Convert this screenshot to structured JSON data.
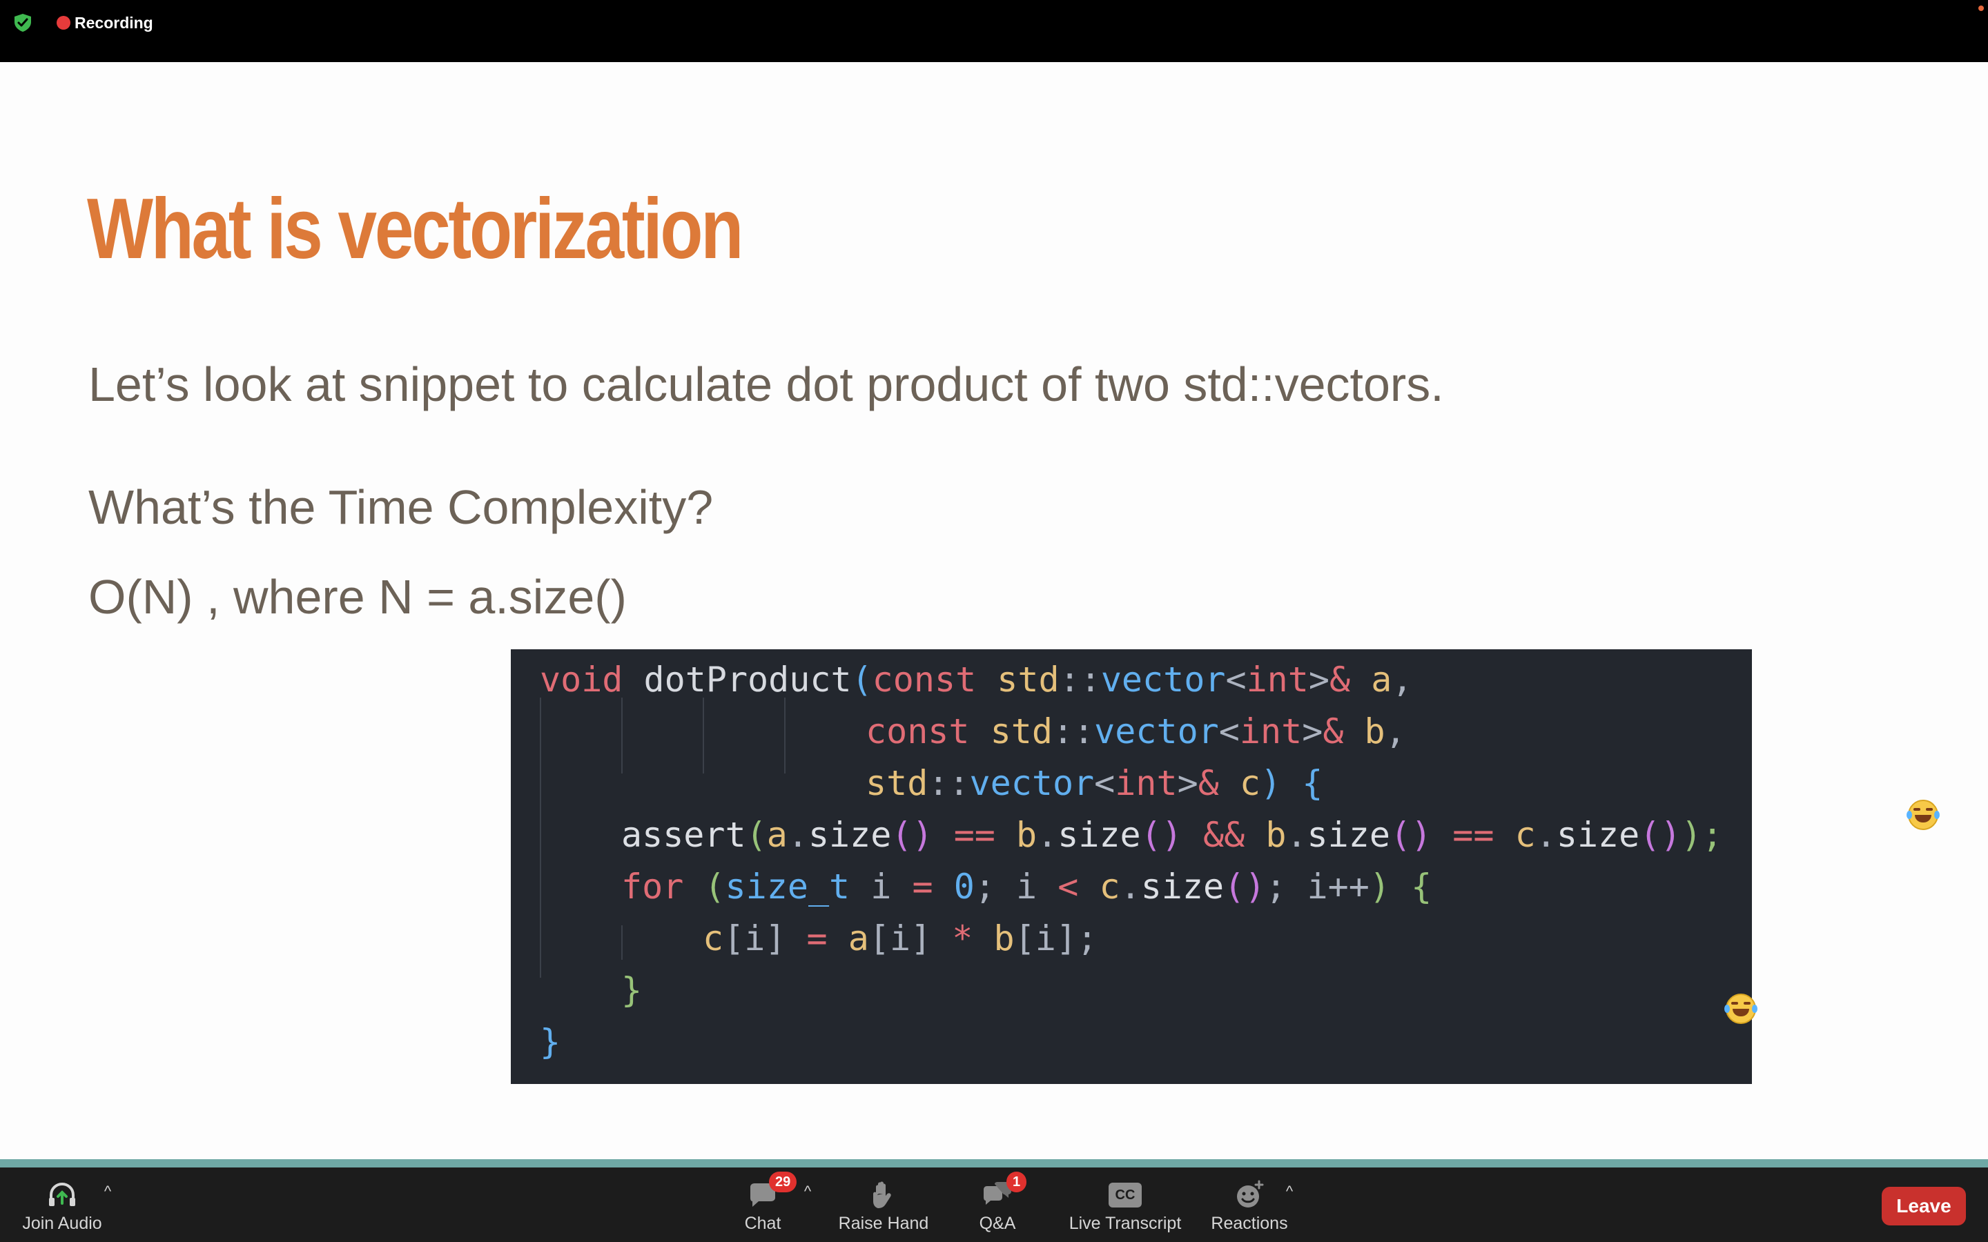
{
  "topbar": {
    "recording_label": "Recording",
    "icons": {
      "security": "shield-check-icon",
      "recording": "record-dot-icon"
    }
  },
  "slide": {
    "title": "What is vectorization",
    "line1": "Let’s look at snippet to calculate dot product of two std::vectors.",
    "line2": "What’s the Time Complexity?",
    "line3": "O(N) , where N = a.size()",
    "colors": {
      "title": "#dd7a39",
      "body": "#6c6257",
      "code_bg": "#23272e"
    },
    "code": {
      "l1_void": "void",
      "l1_fn": "dotProduct",
      "l1_p": "(",
      "l1_const": "const",
      "l1_std": "std",
      "l1_sep": "::",
      "l1_vec": "vector",
      "l1_lt": "<",
      "l1_int": "int",
      "l1_gt": ">",
      "l1_amp": "&",
      "l1_a": "a",
      "l1_comma": ",",
      "l2_const": "const",
      "l2_std": "std",
      "l2_sep": "::",
      "l2_vec": "vector",
      "l2_lt": "<",
      "l2_int": "int",
      "l2_gt": ">",
      "l2_amp": "&",
      "l2_b": "b",
      "l2_comma": ",",
      "l3_std": "std",
      "l3_sep": "::",
      "l3_vec": "vector",
      "l3_lt": "<",
      "l3_int": "int",
      "l3_gt": ">",
      "l3_amp": "&",
      "l3_c": "c",
      "l3_close": ")",
      "l3_brace": "{",
      "l4_assert": "assert",
      "l4_p1": "(",
      "l4_a": "a",
      "l4_dot1": ".",
      "l4_size1": "size",
      "l4_pp1": "()",
      "l4_eq1": "==",
      "l4_b": "b",
      "l4_dot2": ".",
      "l4_size2": "size",
      "l4_pp2": "()",
      "l4_and": "&&",
      "l4_b2": "b",
      "l4_dot3": ".",
      "l4_size3": "size",
      "l4_pp3": "()",
      "l4_eq2": "==",
      "l4_c": "c",
      "l4_dot4": ".",
      "l4_size4": "size",
      "l4_pp4": "()",
      "l4_end": ");",
      "l5_for": "for",
      "l5_p": "(",
      "l5_sizet": "size_t",
      "l5_i": "i",
      "l5_eq": "=",
      "l5_zero": "0",
      "l5_semi1": ";",
      "l5_i2": "i",
      "l5_lt": "<",
      "l5_c": "c",
      "l5_dot": ".",
      "l5_size": "size",
      "l5_pp": "()",
      "l5_semi2": ";",
      "l5_ipp": "i++",
      "l5_close": ")",
      "l5_brace": "{",
      "l6_text_c": "c",
      "l6_idx1": "[i]",
      "l6_eq": "=",
      "l6_a": "a",
      "l6_idx2": "[i]",
      "l6_mul": "*",
      "l6_b": "b",
      "l6_idx3": "[i]",
      "l6_semi": ";",
      "l7_brace": "}",
      "l8_brace": "}"
    }
  },
  "reactions_overlay": [
    "face-with-tears-of-joy-icon",
    "face-with-tears-of-joy-icon"
  ],
  "toolbar": {
    "join_audio": "Join Audio",
    "chat": "Chat",
    "chat_badge": "29",
    "raise_hand": "Raise Hand",
    "qa": "Q&A",
    "qa_badge": "1",
    "live_transcript": "Live Transcript",
    "cc_text": "CC",
    "reactions": "Reactions",
    "leave": "Leave",
    "caret": "^"
  }
}
